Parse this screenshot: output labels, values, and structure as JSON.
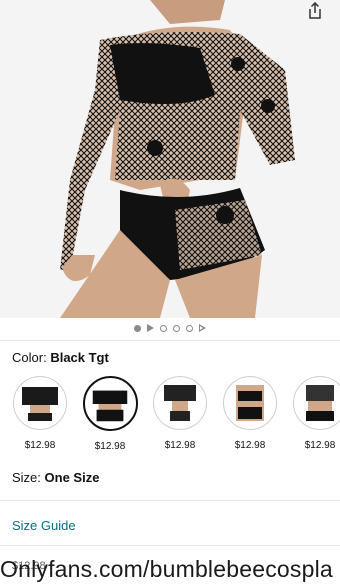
{
  "product": {
    "image_icon": "product-photo-bodysuit",
    "share_icon": "share-icon"
  },
  "pager": {
    "slides": [
      "dot",
      "video",
      "dot",
      "dot",
      "dot",
      "video"
    ],
    "active_index": 0
  },
  "color": {
    "label": "Color:",
    "selected": "Black Tgt"
  },
  "swatches": [
    {
      "price": "$12.98",
      "selected": false
    },
    {
      "price": "$12.98",
      "selected": true
    },
    {
      "price": "$12.98",
      "selected": false
    },
    {
      "price": "$12.98",
      "selected": false
    },
    {
      "price": "$12.98",
      "selected": false
    }
  ],
  "size": {
    "label": "Size:",
    "selected": "One Size"
  },
  "size_guide": "Size Guide",
  "bottom": {
    "price_partial": "$12.98",
    "watermark": "Onlyfans.com/bumblebeecospla"
  },
  "colors": {
    "link": "#007185",
    "text": "#0f1111",
    "divider": "#e7e7e7"
  }
}
